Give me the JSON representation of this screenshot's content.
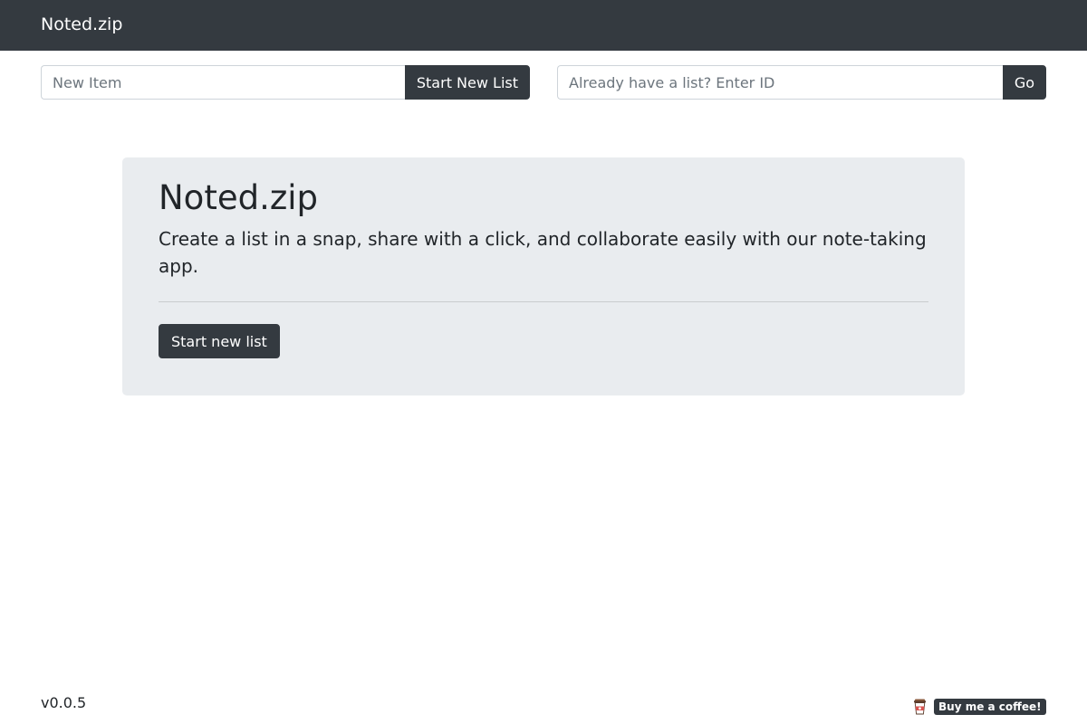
{
  "navbar": {
    "brand": "Noted.zip",
    "background_color": "#343a40"
  },
  "new_item_form": {
    "placeholder": "New Item",
    "value": "",
    "button_label": "Start New List"
  },
  "enter_id_form": {
    "placeholder": "Already have a list? Enter ID",
    "value": "",
    "button_label": "Go"
  },
  "jumbotron": {
    "title": "Noted.zip",
    "lead": "Create a list in a snap, share with a click, and collaborate easily with our note-taking app.",
    "button_label": "Start new list",
    "background_color": "#e9ecef"
  },
  "footer": {
    "version": "v0.0.5",
    "coffee_icon": "coffee-cup-icon",
    "coffee_label": "Buy me a coffee!"
  },
  "colors": {
    "dark": "#343a40",
    "text": "#212529",
    "muted": "#6c757d"
  }
}
